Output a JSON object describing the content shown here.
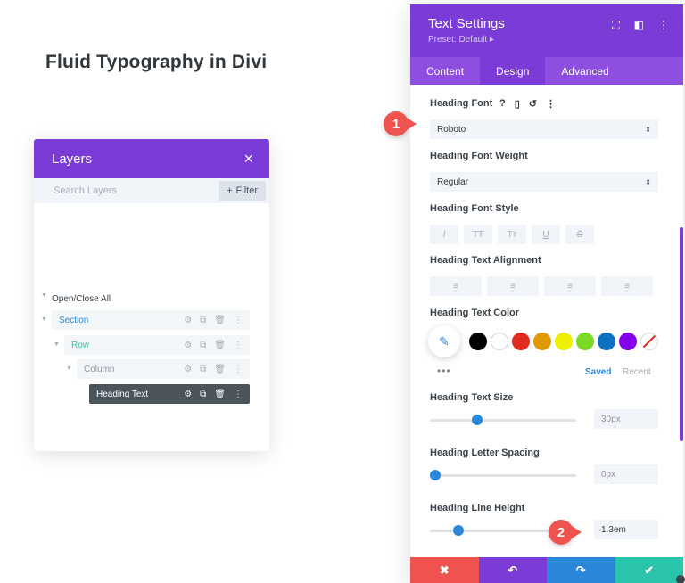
{
  "page": {
    "title": "Fluid Typography in Divi"
  },
  "layers": {
    "title": "Layers",
    "close_icon": "×",
    "search_placeholder": "Search Layers",
    "filter_label": "Filter",
    "open_close_all": "Open/Close All",
    "items": {
      "section": "Section",
      "row": "Row",
      "column": "Column",
      "heading": "Heading Text"
    }
  },
  "settings": {
    "title": "Text Settings",
    "preset": "Preset: Default ▸",
    "tabs": [
      "Content",
      "Design",
      "Advanced"
    ],
    "active_tab": "Design",
    "heading_font_label": "Heading Font",
    "heading_font_value": "Roboto",
    "heading_font_weight_label": "Heading Font Weight",
    "heading_font_weight_value": "Regular",
    "heading_font_style_label": "Heading Font Style",
    "font_style_buttons": [
      "I",
      "TT",
      "Tт",
      "U",
      "S"
    ],
    "heading_text_alignment_label": "Heading Text Alignment",
    "heading_text_color_label": "Heading Text Color",
    "color_swatches": [
      "#000000",
      "#ffffff",
      "#e02b20",
      "#e09900",
      "#edf000",
      "#7cda24",
      "#0c71c3",
      "#8300e9"
    ],
    "saved_label": "Saved",
    "recent_label": "Recent",
    "heading_text_size_label": "Heading Text Size",
    "heading_text_size_value": "30px",
    "heading_text_size_level": 0.31,
    "heading_letter_spacing_label": "Heading Letter Spacing",
    "heading_letter_spacing_value": "0px",
    "heading_letter_spacing_level": 0.0,
    "heading_line_height_label": "Heading Line Height",
    "heading_line_height_value": "1.3em",
    "heading_line_height_level": 0.17
  },
  "callouts": [
    "1",
    "2"
  ],
  "colors": {
    "purple": "#7b3bd6",
    "tab_purple": "#8e4fe0",
    "blue": "#2b87da",
    "red": "#ef5350",
    "footer": [
      "#ef5350",
      "#7b3bd6",
      "#2b87da",
      "#29c4a9"
    ]
  }
}
